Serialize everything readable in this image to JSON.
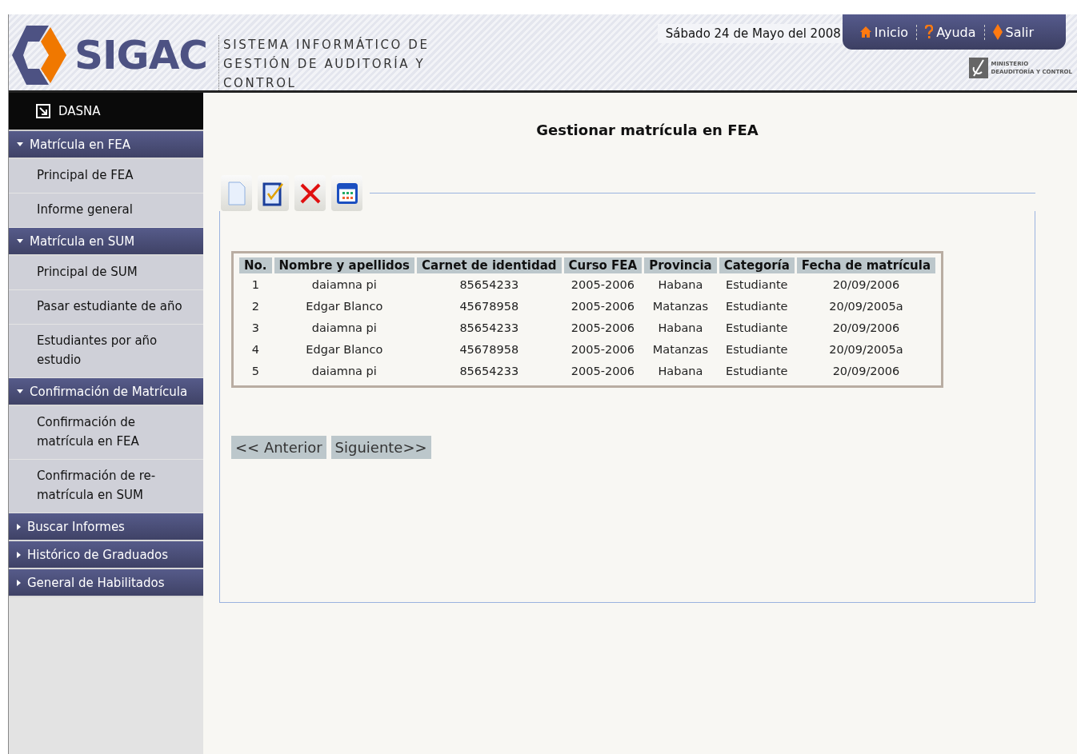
{
  "header": {
    "logo": "SIGAC",
    "subtitle": "SISTEMA INFORMÁTICO DE GESTIÓN DE AUDITORÍA Y CONTROL",
    "date": "Sábado 24 de Mayo del 2008",
    "nav": [
      {
        "kind": "home",
        "label": "Inicio"
      },
      {
        "kind": "help",
        "label": "Ayuda"
      },
      {
        "kind": "exit",
        "label": "Salir"
      }
    ],
    "ministry": {
      "line_1": "MINISTERIO",
      "line_2": "DEAUDITORÍA Y CONTROL"
    }
  },
  "sidebar": {
    "user": "DASNA",
    "groups": [
      {
        "label": "Matrícula en FEA",
        "expanded": true,
        "items": [
          "Principal de FEA",
          "Informe general"
        ]
      },
      {
        "label": "Matrícula en SUM",
        "expanded": true,
        "items": [
          "Principal de SUM",
          "Pasar estudiante de año",
          "Estudiantes por año estudio"
        ]
      },
      {
        "label": "Confirmación de Matrícula",
        "expanded": true,
        "items": [
          "Confirmación de matrícula en FEA",
          "Confirmación de re-matrícula en SUM"
        ]
      },
      {
        "label": "Buscar Informes",
        "expanded": false
      },
      {
        "label": "Histórico de Graduados",
        "expanded": false
      },
      {
        "label": "General de Habilitados",
        "expanded": false
      }
    ]
  },
  "content": {
    "title": "Gestionar matrícula en FEA",
    "toolbar": [
      {
        "kind": "new"
      },
      {
        "kind": "edit"
      },
      {
        "kind": "delete"
      },
      {
        "kind": "grid"
      }
    ],
    "table": {
      "columns": [
        "No.",
        "Nombre y apellidos",
        "Carnet de identidad",
        "Curso FEA",
        "Provincia",
        "Categoría",
        "Fecha de matrícula"
      ],
      "rows": [
        [
          "1",
          "daiamna pi",
          "85654233",
          "2005-2006",
          "Habana",
          "Estudiante",
          "20/09/2006"
        ],
        [
          "2",
          "Edgar Blanco",
          "45678958",
          "2005-2006",
          "Matanzas",
          "Estudiante",
          "20/09/2005a"
        ],
        [
          "3",
          "daiamna pi",
          "85654233",
          "2005-2006",
          "Habana",
          "Estudiante",
          "20/09/2006"
        ],
        [
          "4",
          "Edgar Blanco",
          "45678958",
          "2005-2006",
          "Matanzas",
          "Estudiante",
          "20/09/2005a"
        ],
        [
          "5",
          "daiamna pi",
          "85654233",
          "2005-2006",
          "Habana",
          "Estudiante",
          "20/09/2006"
        ]
      ]
    },
    "pagination": [
      "<< Anterior",
      "Siguiente>>"
    ]
  }
}
